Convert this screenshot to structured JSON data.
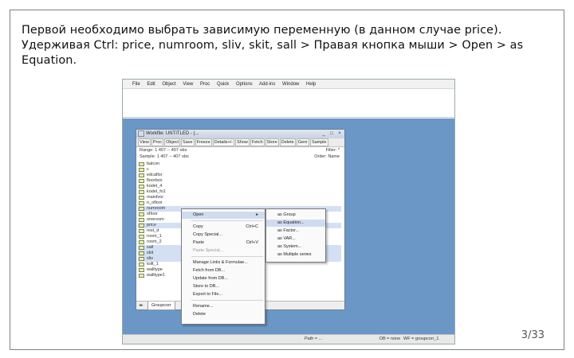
{
  "caption": "Первой необходимо выбрать зависимую переменную (в данном случае price). Удерживая Ctrl: price, numroom, sliv, skit, sall > Правая кнопка мыши > Open > as Equation.",
  "page_number": "3/33",
  "menubar": [
    "File",
    "Edit",
    "Object",
    "View",
    "Proc",
    "Quick",
    "Options",
    "Add-ins",
    "Window",
    "Help"
  ],
  "workfile": {
    "title": "Workfile: UNTITLED - (...",
    "toolbar": [
      "View",
      "Proc",
      "Object",
      "Save",
      "Freeze",
      "Details+/-",
      "Show",
      "Fetch",
      "Store",
      "Delete",
      "Genr",
      "Sample"
    ],
    "range": "Range:  1 407  --  407 obs",
    "sample": "Sample:  1 407  --  407 obs",
    "filter": "Filter: *",
    "order": "Order: Name",
    "items": [
      {
        "label": "balcon",
        "selected": false
      },
      {
        "label": "c",
        "selected": false
      },
      {
        "label": "edcaflor",
        "selected": false
      },
      {
        "label": "floorbox",
        "selected": false
      },
      {
        "label": "kodel_4",
        "selected": false
      },
      {
        "label": "kodel_fo1",
        "selected": false
      },
      {
        "label": "mainfvor",
        "selected": false
      },
      {
        "label": "n_ofloor",
        "selected": false
      },
      {
        "label": "numroom",
        "selected": true
      },
      {
        "label": "ofloor",
        "selected": false
      },
      {
        "label": "oneroom",
        "selected": false
      },
      {
        "label": "price",
        "selected": true
      },
      {
        "label": "rest_d",
        "selected": false
      },
      {
        "label": "room_1",
        "selected": false
      },
      {
        "label": "room_2",
        "selected": false
      },
      {
        "label": "sall",
        "selected": true
      },
      {
        "label": "skit",
        "selected": true
      },
      {
        "label": "sliv",
        "selected": true
      },
      {
        "label": "toilt_1",
        "selected": false
      },
      {
        "label": "walltype",
        "selected": false
      },
      {
        "label": "walltype1",
        "selected": false
      }
    ],
    "tab": "Groupcorr",
    "tab_new": "New Page"
  },
  "context_menu": [
    {
      "label": "Open",
      "shortcut": "▸",
      "highlight": true,
      "disabled": false
    },
    {
      "label": "Copy",
      "shortcut": "Ctrl+C",
      "highlight": false,
      "disabled": false
    },
    {
      "label": "Copy Special...",
      "shortcut": "",
      "highlight": false,
      "disabled": false
    },
    {
      "label": "Paste",
      "shortcut": "Ctrl+V",
      "highlight": false,
      "disabled": false
    },
    {
      "label": "Paste Special...",
      "shortcut": "",
      "highlight": false,
      "disabled": true
    },
    {
      "label": "Manage Links & Formulae...",
      "shortcut": "",
      "highlight": false,
      "disabled": false
    },
    {
      "label": "Fetch from DB...",
      "shortcut": "",
      "highlight": false,
      "disabled": false
    },
    {
      "label": "Update from DB...",
      "shortcut": "",
      "highlight": false,
      "disabled": false
    },
    {
      "label": "Store to DB...",
      "shortcut": "",
      "highlight": false,
      "disabled": false
    },
    {
      "label": "Export to File...",
      "shortcut": "",
      "highlight": false,
      "disabled": false
    },
    {
      "label": "Rename...",
      "shortcut": "",
      "highlight": false,
      "disabled": false
    },
    {
      "label": "Delete",
      "shortcut": "",
      "highlight": false,
      "disabled": false
    }
  ],
  "submenu": [
    {
      "label": "as Group",
      "highlight": false
    },
    {
      "label": "as Equation...",
      "highlight": true
    },
    {
      "label": "as Factor...",
      "highlight": false
    },
    {
      "label": "as VAR...",
      "highlight": false
    },
    {
      "label": "as System...",
      "highlight": false
    },
    {
      "label": "as Multiple series",
      "highlight": false
    }
  ],
  "status": {
    "path": "Path = ...",
    "db": "DB = none",
    "wf": "WF = groupcorr_1"
  }
}
